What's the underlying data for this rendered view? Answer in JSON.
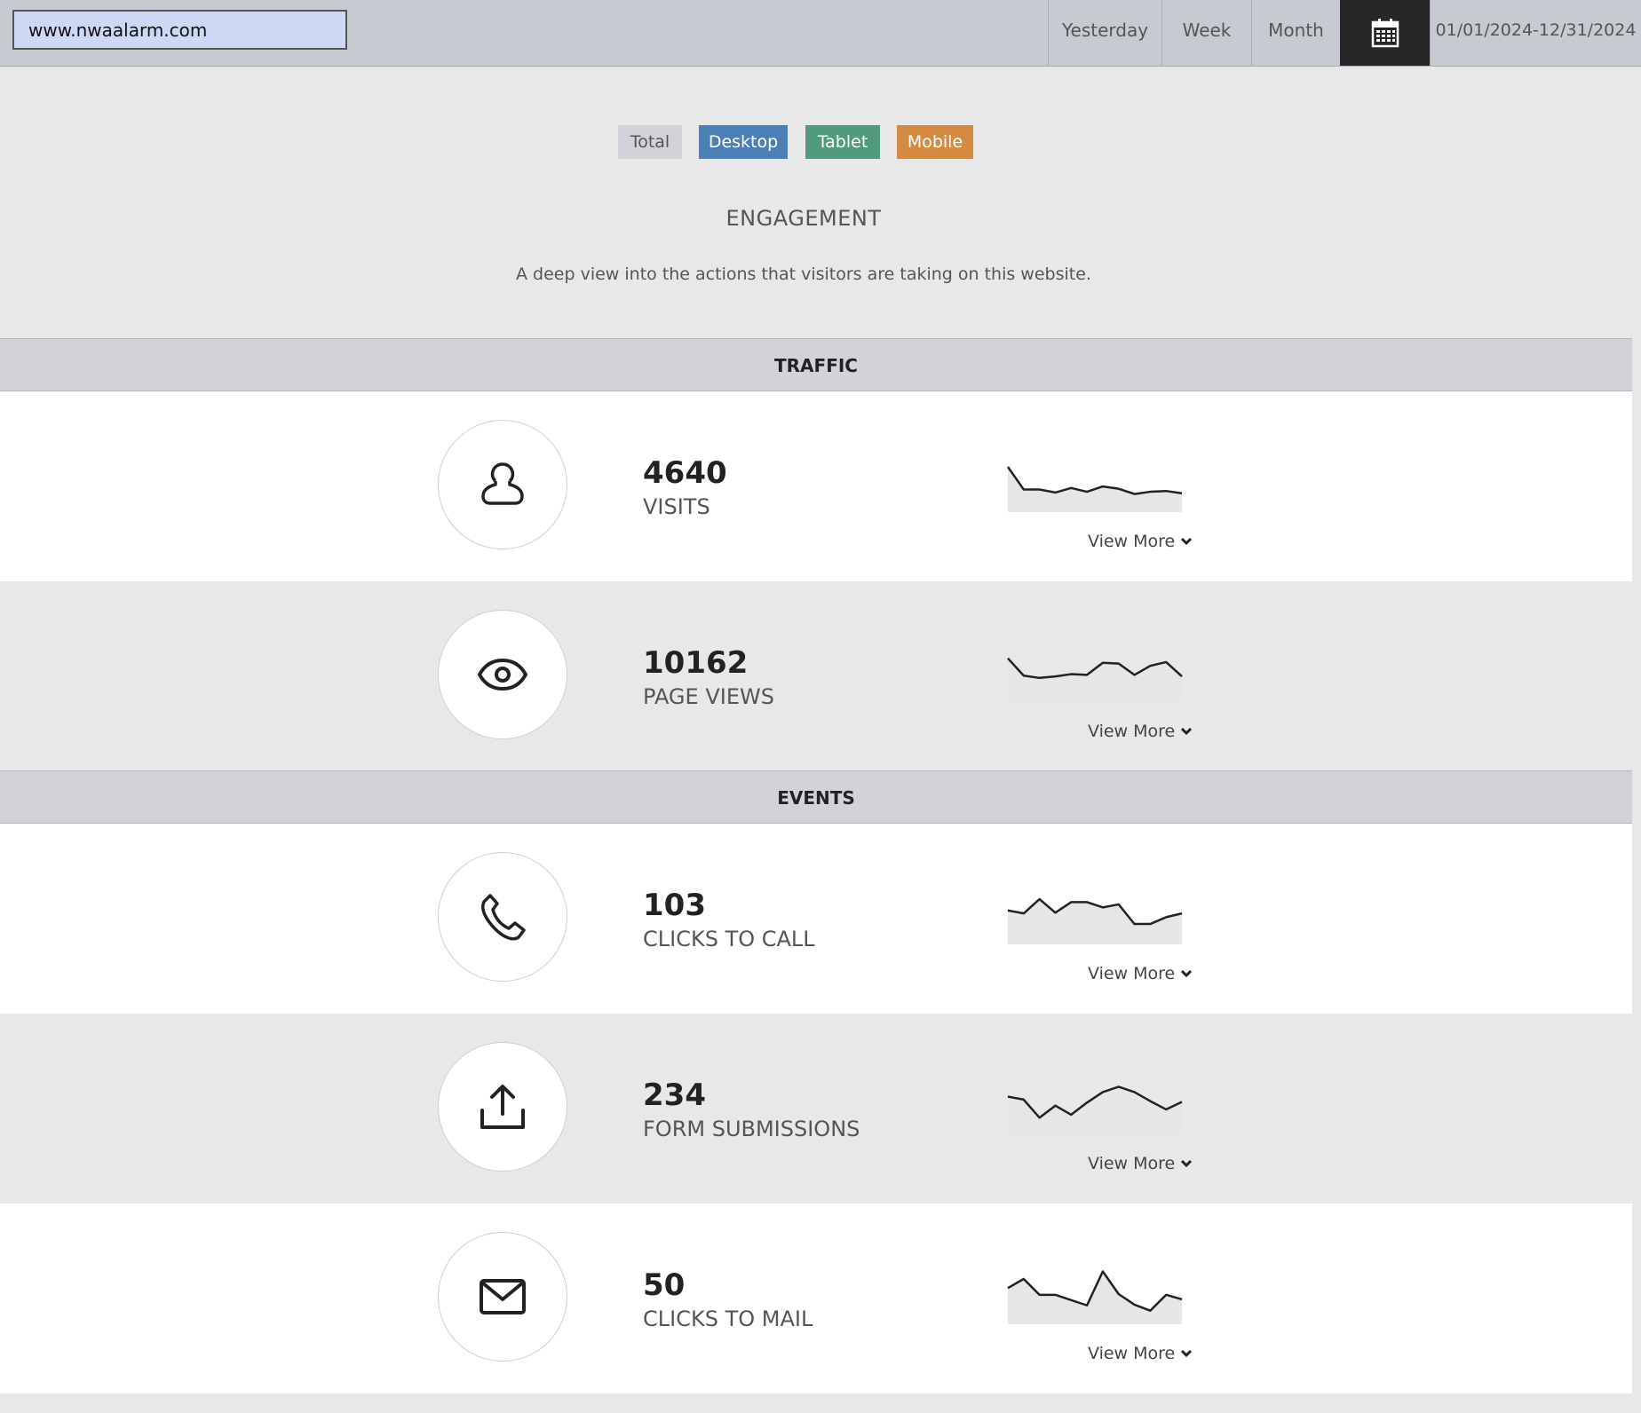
{
  "header": {
    "url": "www.nwaalarm.com",
    "ranges": [
      "Yesterday",
      "Week",
      "Month"
    ],
    "date_range": "01/01/2024-12/31/2024"
  },
  "filters": {
    "total": "Total",
    "desktop": "Desktop",
    "tablet": "Tablet",
    "mobile": "Mobile",
    "colors": {
      "total": "#d2d3d8",
      "desktop": "#4b7fb5",
      "tablet": "#519a7d",
      "mobile": "#d58a44"
    }
  },
  "page": {
    "title": "ENGAGEMENT",
    "subtitle": "A deep view into the actions that visitors are taking on this website."
  },
  "sections": {
    "traffic": "TRAFFIC",
    "events": "EVENTS"
  },
  "view_more": "View More",
  "metrics": {
    "visits": {
      "value": "4640",
      "label": "VISITS",
      "icon": "user-icon",
      "trend": [
        60,
        30,
        30,
        26,
        32,
        27,
        34,
        31,
        24,
        27,
        28,
        25
      ]
    },
    "page_views": {
      "value": "10162",
      "label": "PAGE VIEWS",
      "icon": "eye-icon",
      "trend": [
        58,
        35,
        32,
        34,
        37,
        36,
        52,
        51,
        36,
        48,
        53,
        34
      ]
    },
    "clicks_to_call": {
      "value": "103",
      "label": "CLICKS TO CALL",
      "icon": "phone-icon",
      "trend": [
        45,
        41,
        60,
        42,
        56,
        56,
        49,
        53,
        27,
        27,
        36,
        41
      ]
    },
    "form_submissions": {
      "value": "234",
      "label": "FORM SUBMISSIONS",
      "icon": "upload-icon",
      "trend": [
        50,
        46,
        22,
        38,
        26,
        42,
        56,
        63,
        56,
        44,
        33,
        43
      ]
    },
    "clicks_to_mail": {
      "value": "50",
      "label": "CLICKS TO MAIL",
      "icon": "mail-icon",
      "trend": [
        48,
        60,
        39,
        39,
        32,
        25,
        70,
        40,
        26,
        18,
        39,
        33
      ]
    }
  }
}
